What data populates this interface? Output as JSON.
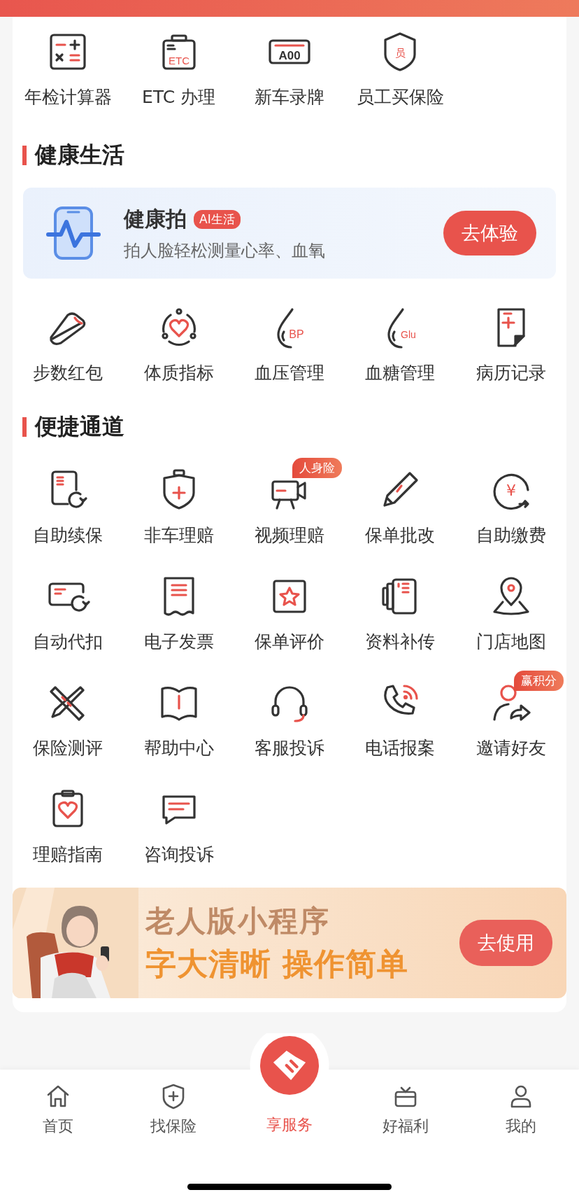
{
  "top_grid": {
    "items": [
      {
        "label": "年检计算器"
      },
      {
        "label": "ETC 办理",
        "icon_text": "ETC"
      },
      {
        "label": "新车录牌",
        "icon_text": "A00"
      },
      {
        "label": "员工买保险",
        "icon_text": "员"
      }
    ]
  },
  "health": {
    "title": "健康生活",
    "promo": {
      "title": "健康拍",
      "tag": "AI生活",
      "subtitle": "拍人脸轻松测量心率、血氧",
      "button": "去体验"
    },
    "items": [
      {
        "label": "步数红包"
      },
      {
        "label": "体质指标"
      },
      {
        "label": "血压管理",
        "icon_text": "BP"
      },
      {
        "label": "血糖管理",
        "icon_text": "Glu"
      },
      {
        "label": "病历记录"
      }
    ]
  },
  "shortcuts": {
    "title": "便捷通道",
    "items": [
      {
        "label": "自助续保"
      },
      {
        "label": "非车理赔"
      },
      {
        "label": "视频理赔",
        "badge": "人身险"
      },
      {
        "label": "保单批改"
      },
      {
        "label": "自助缴费",
        "icon_text": "¥"
      },
      {
        "label": "自动代扣"
      },
      {
        "label": "电子发票"
      },
      {
        "label": "保单评价"
      },
      {
        "label": "资料补传"
      },
      {
        "label": "门店地图"
      },
      {
        "label": "保险测评"
      },
      {
        "label": "帮助中心"
      },
      {
        "label": "客服投诉"
      },
      {
        "label": "电话报案"
      },
      {
        "label": "邀请好友",
        "badge": "赢积分"
      },
      {
        "label": "理赔指南"
      },
      {
        "label": "咨询投诉"
      }
    ]
  },
  "banner": {
    "line1": "老人版小程序",
    "line2": "字大清晰 操作简单",
    "button": "去使用"
  },
  "tab_bar": [
    {
      "label": "首页",
      "selected": false
    },
    {
      "label": "找保险",
      "selected": false
    },
    {
      "label": "享服务",
      "selected": true
    },
    {
      "label": "好福利",
      "selected": false
    },
    {
      "label": "我的",
      "selected": false
    }
  ]
}
